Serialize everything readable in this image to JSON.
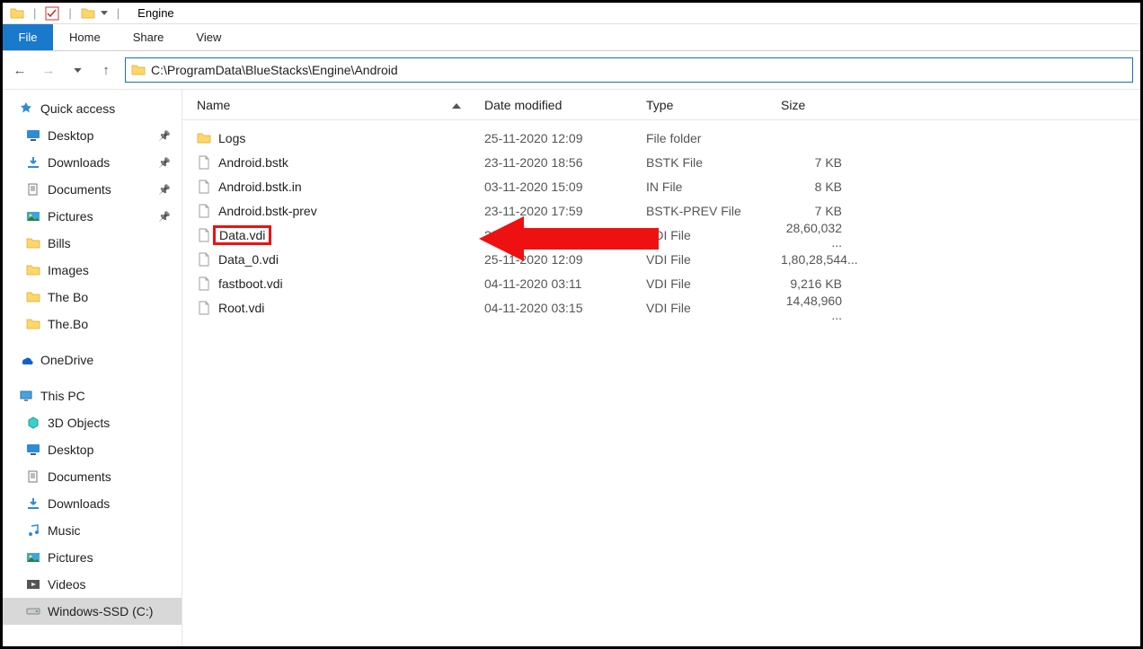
{
  "window": {
    "title": "Engine"
  },
  "ribbon": {
    "file": "File",
    "tabs": [
      "Home",
      "Share",
      "View"
    ]
  },
  "address": {
    "path": "C:\\ProgramData\\BlueStacks\\Engine\\Android"
  },
  "columns": {
    "name": "Name",
    "date": "Date modified",
    "type": "Type",
    "size": "Size"
  },
  "sidebar": {
    "quick": {
      "label": "Quick access",
      "items": [
        {
          "label": "Desktop",
          "pinned": true,
          "icon": "desktop"
        },
        {
          "label": "Downloads",
          "pinned": true,
          "icon": "downloads"
        },
        {
          "label": "Documents",
          "pinned": true,
          "icon": "documents"
        },
        {
          "label": "Pictures",
          "pinned": true,
          "icon": "pictures"
        },
        {
          "label": "Bills",
          "pinned": false,
          "icon": "folder"
        },
        {
          "label": "Images",
          "pinned": false,
          "icon": "folder"
        },
        {
          "label": "The Bo",
          "pinned": false,
          "icon": "folder"
        },
        {
          "label": "The.Bo",
          "pinned": false,
          "icon": "folder"
        }
      ]
    },
    "onedrive": {
      "label": "OneDrive"
    },
    "thispc": {
      "label": "This PC",
      "items": [
        {
          "label": "3D Objects",
          "icon": "3d"
        },
        {
          "label": "Desktop",
          "icon": "desktop"
        },
        {
          "label": "Documents",
          "icon": "documents"
        },
        {
          "label": "Downloads",
          "icon": "downloads"
        },
        {
          "label": "Music",
          "icon": "music"
        },
        {
          "label": "Pictures",
          "icon": "pictures"
        },
        {
          "label": "Videos",
          "icon": "videos"
        },
        {
          "label": "Windows-SSD (C:)",
          "icon": "drive",
          "selected": true
        }
      ]
    }
  },
  "files": [
    {
      "name": "Logs",
      "date": "25-11-2020 12:09",
      "type": "File folder",
      "size": "",
      "icon": "folder"
    },
    {
      "name": "Android.bstk",
      "date": "23-11-2020 18:56",
      "type": "BSTK File",
      "size": "7 KB",
      "icon": "file"
    },
    {
      "name": "Android.bstk.in",
      "date": "03-11-2020 15:09",
      "type": "IN File",
      "size": "8 KB",
      "icon": "file"
    },
    {
      "name": "Android.bstk-prev",
      "date": "23-11-2020 17:59",
      "type": "BSTK-PREV File",
      "size": "7 KB",
      "icon": "file"
    },
    {
      "name": "Data.vdi",
      "date": "23-12-2019 20:50",
      "type": "VDI File",
      "size": "28,60,032 ...",
      "icon": "file",
      "highlight": true
    },
    {
      "name": "Data_0.vdi",
      "date": "25-11-2020 12:09",
      "type": "VDI File",
      "size": "1,80,28,544...",
      "icon": "file"
    },
    {
      "name": "fastboot.vdi",
      "date": "04-11-2020 03:11",
      "type": "VDI File",
      "size": "9,216 KB",
      "icon": "file"
    },
    {
      "name": "Root.vdi",
      "date": "04-11-2020 03:15",
      "type": "VDI File",
      "size": "14,48,960 ...",
      "icon": "file"
    }
  ],
  "annotation": {
    "target": "Data.vdi"
  }
}
